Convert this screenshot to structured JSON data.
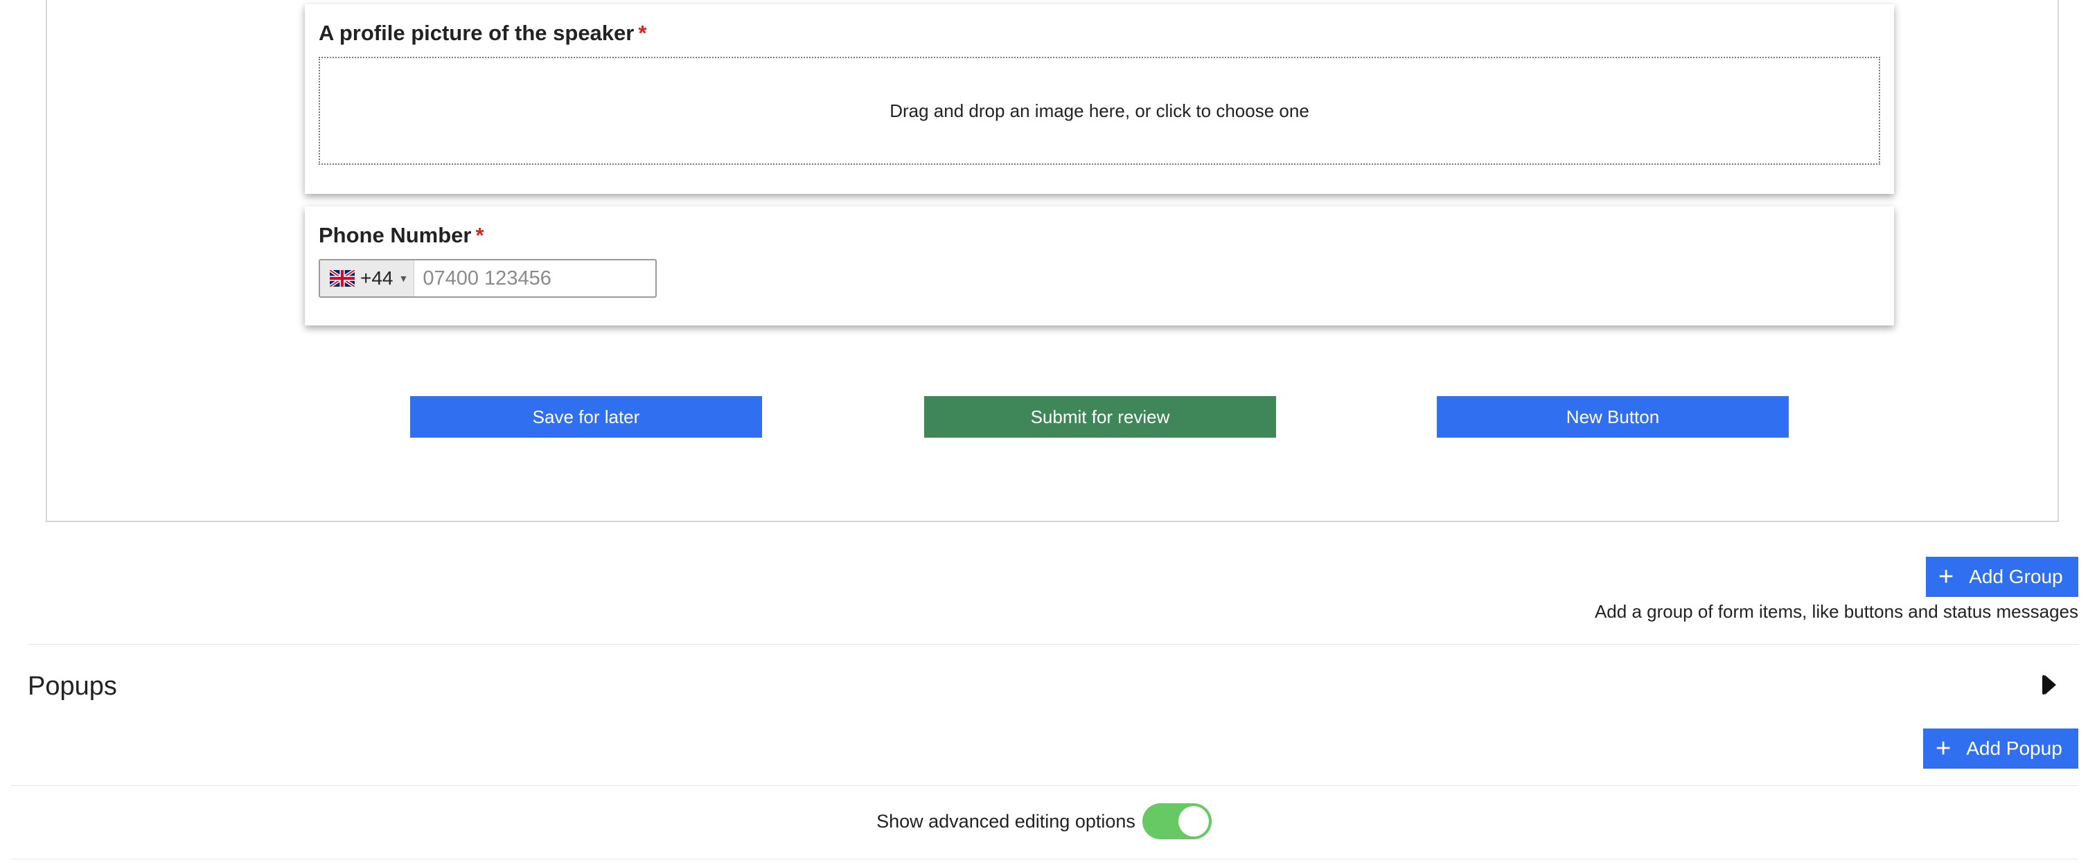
{
  "profile_picture": {
    "label": "A profile picture of the speaker",
    "required_marker": "*",
    "dropzone_text": "Drag and drop an image here, or click to choose one"
  },
  "phone": {
    "label": "Phone Number",
    "required_marker": "*",
    "country_code": "+44",
    "country_flag": "uk-flag-icon",
    "placeholder": "07400 123456",
    "value": ""
  },
  "buttons": {
    "save_label": "Save for later",
    "submit_label": "Submit for review",
    "new_label": "New Button"
  },
  "groups": {
    "add_group_label": "Add Group",
    "hint": "Add a group of form items, like buttons and status messages"
  },
  "popups": {
    "title": "Popups",
    "add_popup_label": "Add Popup"
  },
  "advanced": {
    "label": "Show advanced editing options",
    "enabled": true
  },
  "colors": {
    "primary": "#306ff0",
    "success": "#3f8658",
    "toggle_on": "#67c964",
    "required": "#d9231d"
  }
}
